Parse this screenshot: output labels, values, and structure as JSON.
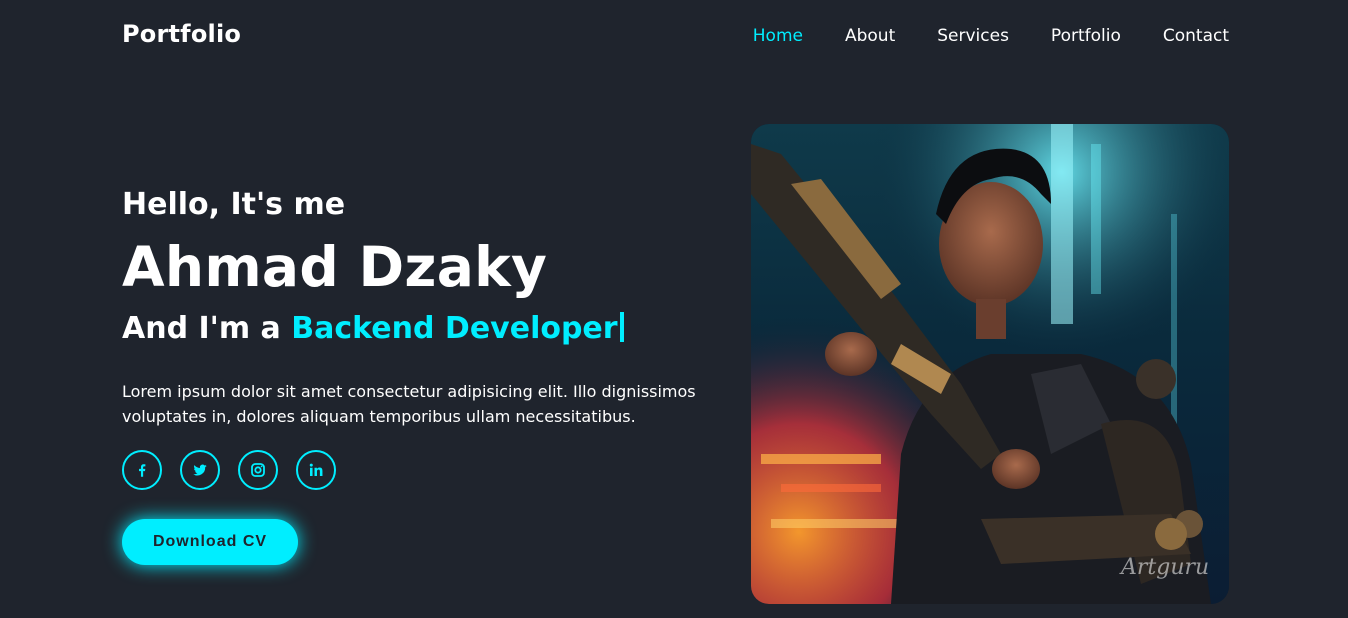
{
  "header": {
    "logo": "Portfolio",
    "nav": [
      {
        "label": "Home",
        "active": true
      },
      {
        "label": "About",
        "active": false
      },
      {
        "label": "Services",
        "active": false
      },
      {
        "label": "Portfolio",
        "active": false
      },
      {
        "label": "Contact",
        "active": false
      }
    ]
  },
  "hero": {
    "greeting": "Hello, It's me",
    "name": "Ahmad Dzaky",
    "role_prefix": "And I'm a",
    "role_highlight": "Backend Developer",
    "description": "Lorem ipsum dolor sit amet consectetur adipisicing elit. Illo dignissimos voluptates in, dolores aliquam temporibus ullam necessitatibus.",
    "socials": [
      "facebook-icon",
      "twitter-icon",
      "instagram-icon",
      "linkedin-icon"
    ],
    "button_label": "Download CV"
  },
  "image": {
    "watermark": "Artguru"
  },
  "colors": {
    "background": "#1f242d",
    "accent": "#00eeff",
    "text": "#ffffff"
  }
}
